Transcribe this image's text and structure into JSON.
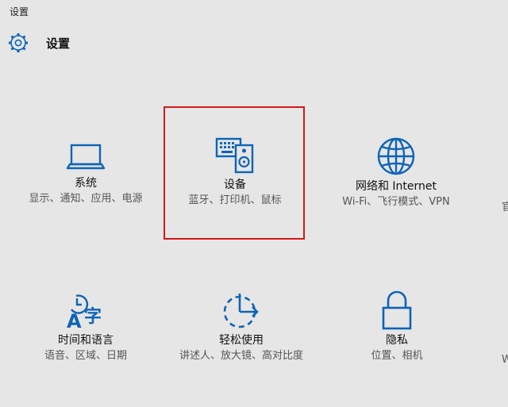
{
  "window": {
    "title": "设置"
  },
  "header": {
    "title": "设置",
    "icon": "gear-icon"
  },
  "colors": {
    "accent": "#0e64b6",
    "highlight": "#d0191b",
    "background": "#e6e6e6"
  },
  "tiles": [
    {
      "name": "系统",
      "desc": "显示、通知、应用、电源",
      "icon": "laptop-icon"
    },
    {
      "name": "设备",
      "desc": "蓝牙、打印机、鼠标",
      "icon": "device-icon",
      "highlighted": true
    },
    {
      "name": "网络和 Internet",
      "desc": "Wi-Fi、飞行模式、VPN",
      "icon": "globe-icon"
    },
    {
      "name": "时间和语言",
      "desc": "语音、区域、日期",
      "icon": "time-language-icon"
    },
    {
      "name": "轻松使用",
      "desc": "讲述人、放大镜、高对比度",
      "icon": "ease-of-access-icon"
    },
    {
      "name": "隐私",
      "desc": "位置、相机",
      "icon": "lock-icon"
    }
  ],
  "edge": {
    "row1": "官",
    "row2": "W"
  }
}
